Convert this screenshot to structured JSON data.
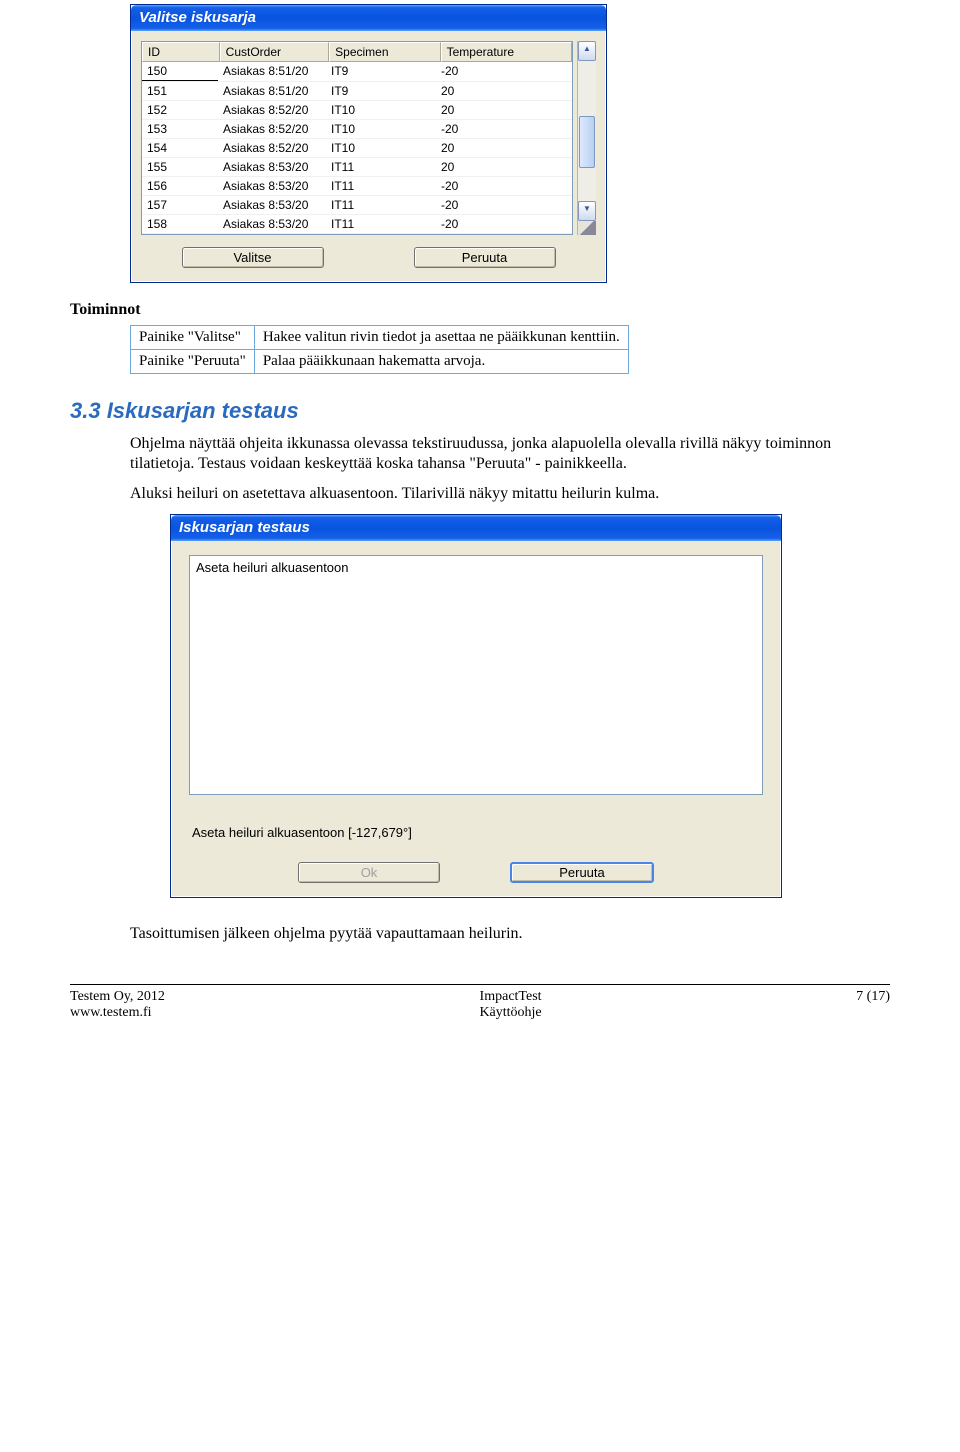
{
  "dialog1": {
    "title": "Valitse iskusarja",
    "columns": [
      "ID",
      "CustOrder",
      "Specimen",
      "Temperature"
    ],
    "rows": [
      {
        "id": "150",
        "cust": "Asiakas 8:51/20",
        "spec": "IT9",
        "temp": "-20"
      },
      {
        "id": "151",
        "cust": "Asiakas 8:51/20",
        "spec": "IT9",
        "temp": "20"
      },
      {
        "id": "152",
        "cust": "Asiakas 8:52/20",
        "spec": "IT10",
        "temp": "20"
      },
      {
        "id": "153",
        "cust": "Asiakas 8:52/20",
        "spec": "IT10",
        "temp": "-20"
      },
      {
        "id": "154",
        "cust": "Asiakas 8:52/20",
        "spec": "IT10",
        "temp": "20"
      },
      {
        "id": "155",
        "cust": "Asiakas 8:53/20",
        "spec": "IT11",
        "temp": "20"
      },
      {
        "id": "156",
        "cust": "Asiakas 8:53/20",
        "spec": "IT11",
        "temp": "-20"
      },
      {
        "id": "157",
        "cust": "Asiakas 8:53/20",
        "spec": "IT11",
        "temp": "-20"
      },
      {
        "id": "158",
        "cust": "Asiakas 8:53/20",
        "spec": "IT11",
        "temp": "-20"
      }
    ],
    "buttons": {
      "valitse": "Valitse",
      "peruuta": "Peruuta"
    }
  },
  "text": {
    "toiminnot": "Toiminnot",
    "row1a": "Painike \"Valitse\"",
    "row1b": "Hakee valitun rivin tiedot ja asettaa ne pääikkunan kenttiin.",
    "row2a": "Painike \"Peruuta\"",
    "row2b": "Palaa pääikkunaan hakematta arvoja.",
    "section": "3.3 Iskusarjan testaus",
    "p1": "Ohjelma näyttää ohjeita ikkunassa olevassa tekstiruudussa, jonka alapuolella olevalla rivillä näkyy toiminnon tilatietoja. Testaus voidaan keskeyttää koska tahansa \"Peruuta\" - painikkeella.",
    "p2": "Aluksi heiluri on asetettava alkuasentoon. Tilarivillä näkyy mitattu heilurin kulma.",
    "p3": "Tasoittumisen jälkeen ohjelma pyytää vapauttamaan heilurin."
  },
  "dialog2": {
    "title": "Iskusarjan testaus",
    "memo": "Aseta heiluri alkuasentoon",
    "status": "Aseta heiluri alkuasentoon [-127,679°]",
    "buttons": {
      "ok": "Ok",
      "peruuta": "Peruuta"
    }
  },
  "footer": {
    "left1": "Testem Oy, 2012",
    "left2": "www.testem.fi",
    "mid1": "ImpactTest",
    "mid2": "Käyttöohje",
    "right": "7 (17)"
  }
}
